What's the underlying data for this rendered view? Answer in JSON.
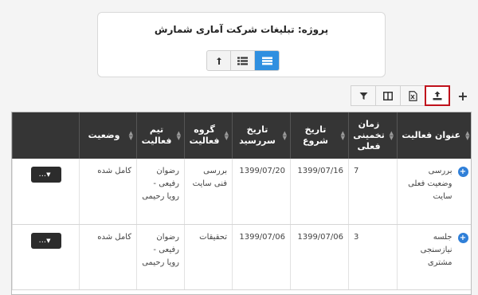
{
  "project": {
    "title": "پروژه: تبلیغات شرکت آماری شمارش"
  },
  "view_switch": {
    "buttons": [
      {
        "icon": "list-table-icon",
        "active": true
      },
      {
        "icon": "list-icon",
        "active": false
      },
      {
        "icon": "sort-icon",
        "active": false
      }
    ]
  },
  "toolbar": {
    "buttons": [
      {
        "icon": "upload-icon",
        "highlighted": true
      },
      {
        "icon": "excel-export-icon",
        "highlighted": false
      },
      {
        "icon": "columns-icon",
        "highlighted": false
      },
      {
        "icon": "filter-icon",
        "highlighted": false
      }
    ],
    "add_label": "+"
  },
  "table": {
    "columns": [
      {
        "label": "عنوان فعالیت"
      },
      {
        "label": "زمان تخمینی فعلی"
      },
      {
        "label": "تاریخ شروع"
      },
      {
        "label": "تاریخ سررسید"
      },
      {
        "label": "گروه فعالیت"
      },
      {
        "label": "تیم فعالیت"
      },
      {
        "label": "وضعیت"
      },
      {
        "label": ""
      }
    ],
    "rows": [
      {
        "title": "بررسی وضعیت فعلی سایت",
        "estimate": "7",
        "start": "1399/07/16",
        "due": "1399/07/20",
        "group": "بررسی فنی سایت",
        "team": "رضوان رفیعی - رویا رحیمی",
        "status": "کامل شده",
        "action": "..."
      },
      {
        "title": "جلسه نیازسنجی مشتری",
        "estimate": "3",
        "start": "1399/07/06",
        "due": "1399/07/06",
        "group": "تحقیقات",
        "team": "رضوان رفیعی - رویا رحیمی",
        "status": "کامل شده",
        "action": "..."
      }
    ]
  }
}
